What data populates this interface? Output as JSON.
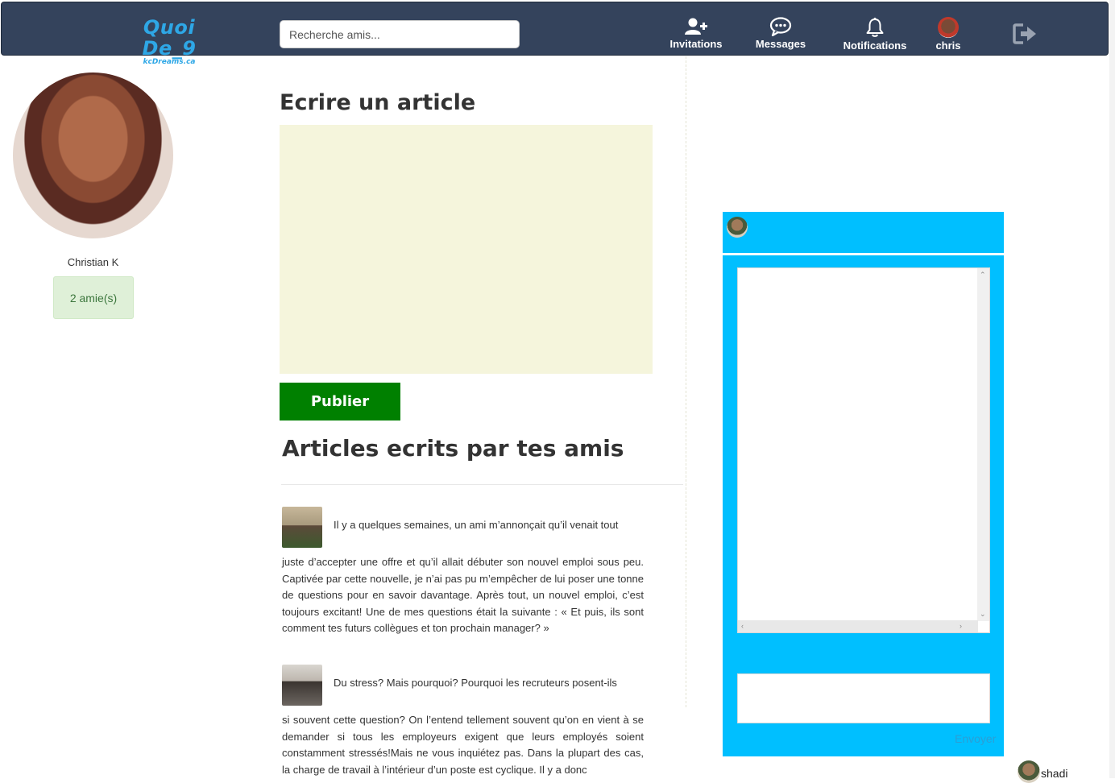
{
  "brand": {
    "title": "Quoi De_9",
    "subtitle": "kcDreams.ca"
  },
  "search": {
    "placeholder": "Recherche amis..."
  },
  "nav": {
    "invitations": "Invitations",
    "messages": "Messages",
    "notifications": "Notifications",
    "user": "chris"
  },
  "profile": {
    "name": "Christian K",
    "friends": "2 amie(s)"
  },
  "composer": {
    "title": "Ecrire un article",
    "publish": "Publier"
  },
  "feed": {
    "title": "Articles ecrits par tes amis",
    "articles": [
      {
        "lead": "Il y a quelques semaines, un ami m’annonçait qu’il venait tout",
        "body": "juste d’accepter une offre et qu’il allait débuter son nouvel emploi sous peu. Captivée par cette nouvelle, je n’ai pas pu m’empêcher de lui poser une tonne de questions pour en savoir davantage. Après tout, un nouvel emploi, c’est toujours excitant! Une de mes questions était la suivante : « Et puis, ils sont comment tes futurs collègues et ton prochain manager? »"
      },
      {
        "lead": "Du stress? Mais pourquoi? Pourquoi les recruteurs posent-ils",
        "body": "si souvent cette question? On l’entend tellement souvent qu’on en vient à se demander si tous les employeurs exigent que leurs employés soient constamment stressés!Mais ne vous inquiétez pas. Dans la plupart des cas, la charge de travail à l’intérieur d’un poste est cyclique. Il y a donc"
      }
    ]
  },
  "chat": {
    "send": "Envoyer"
  },
  "contacts": [
    {
      "name": "shadi"
    }
  ],
  "colors": {
    "navbar": "#34435c",
    "brand": "#2ea7e6",
    "chat": "#00bfff",
    "publish": "#008000",
    "composer_bg": "#f5f5dc",
    "badge_bg": "#dff0d8"
  }
}
